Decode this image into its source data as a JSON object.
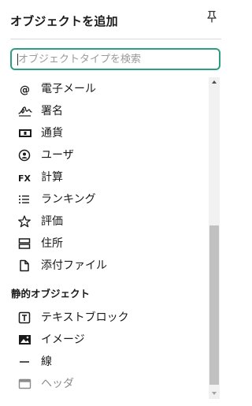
{
  "panel": {
    "title": "オブジェクトを追加",
    "pin_icon": "pin-icon"
  },
  "search": {
    "placeholder": "オブジェクトタイプを検索",
    "value": ""
  },
  "items": [
    {
      "icon": "at-icon",
      "label": "電子メール"
    },
    {
      "icon": "signature-icon",
      "label": "署名"
    },
    {
      "icon": "currency-icon",
      "label": "通貨"
    },
    {
      "icon": "user-icon",
      "label": "ユーザ"
    },
    {
      "icon": "fx-icon",
      "label": "計算"
    },
    {
      "icon": "ranked-list-icon",
      "label": "ランキング"
    },
    {
      "icon": "star-icon",
      "label": "評価"
    },
    {
      "icon": "address-icon",
      "label": "住所"
    },
    {
      "icon": "file-icon",
      "label": "添付ファイル"
    }
  ],
  "static_section": {
    "label": "静的オブジェクト",
    "items": [
      {
        "icon": "text-block-icon",
        "label": "テキストブロック"
      },
      {
        "icon": "image-icon",
        "label": "イメージ"
      },
      {
        "icon": "line-icon",
        "label": "線"
      },
      {
        "icon": "header-icon",
        "label": "ヘッダ",
        "disabled": true
      }
    ]
  },
  "colors": {
    "search_border": "#2e9e80",
    "disabled_text": "#8c8c8c",
    "scroll_thumb": "#c1c1c1"
  }
}
